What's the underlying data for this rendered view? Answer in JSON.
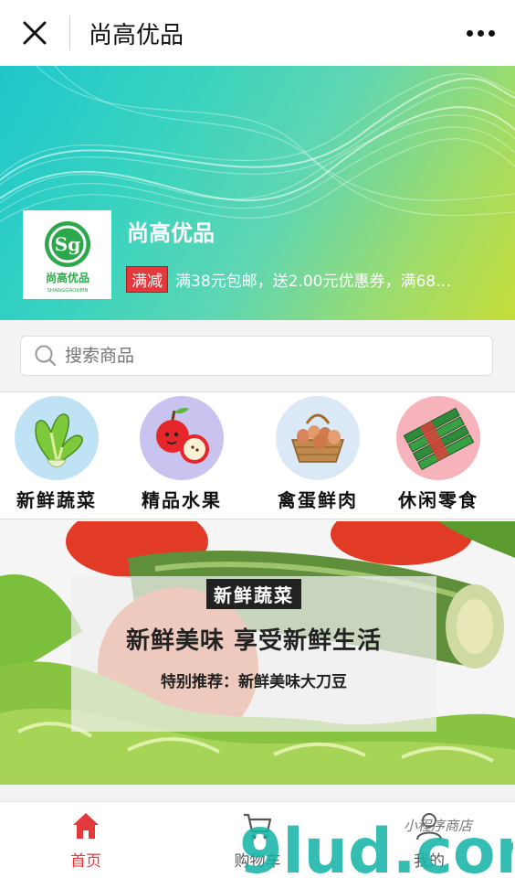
{
  "window": {
    "title": "尚高优品"
  },
  "store": {
    "name": "尚高优品",
    "logo_text": "尚高优品",
    "logo_subtext": "SHANGGAOUPIN",
    "promo_tag": "满减",
    "promo_text": "满38元包邮，送2.00元优惠券，满68…"
  },
  "search": {
    "placeholder": "搜索商品"
  },
  "categories": [
    {
      "label": "新鲜蔬菜",
      "icon": "vegetable-icon",
      "bg": "#bfe3f5"
    },
    {
      "label": "精品水果",
      "icon": "fruit-icon",
      "bg": "#c9c3f0"
    },
    {
      "label": "禽蛋鲜肉",
      "icon": "eggs-icon",
      "bg": "#dbe8f5"
    },
    {
      "label": "休闲零食",
      "icon": "snack-icon",
      "bg": "#f7b3bb"
    }
  ],
  "banner": {
    "badge": "新鲜蔬菜",
    "headline": "新鲜美味  享受新鲜生活",
    "subline": "特别推荐：新鲜美味大刀豆"
  },
  "tabbar": {
    "tabs": [
      {
        "label": "首页",
        "icon": "home-icon",
        "active": true
      },
      {
        "label": "购物车",
        "icon": "cart-icon",
        "active": false
      },
      {
        "label": "我的",
        "icon": "user-icon",
        "active": false
      }
    ]
  },
  "watermark": {
    "text": "9lud.com",
    "caption": "小程序商店"
  },
  "colors": {
    "accent": "#e4393c",
    "active_tab": "#e4393c",
    "inactive_tab": "#555555"
  }
}
